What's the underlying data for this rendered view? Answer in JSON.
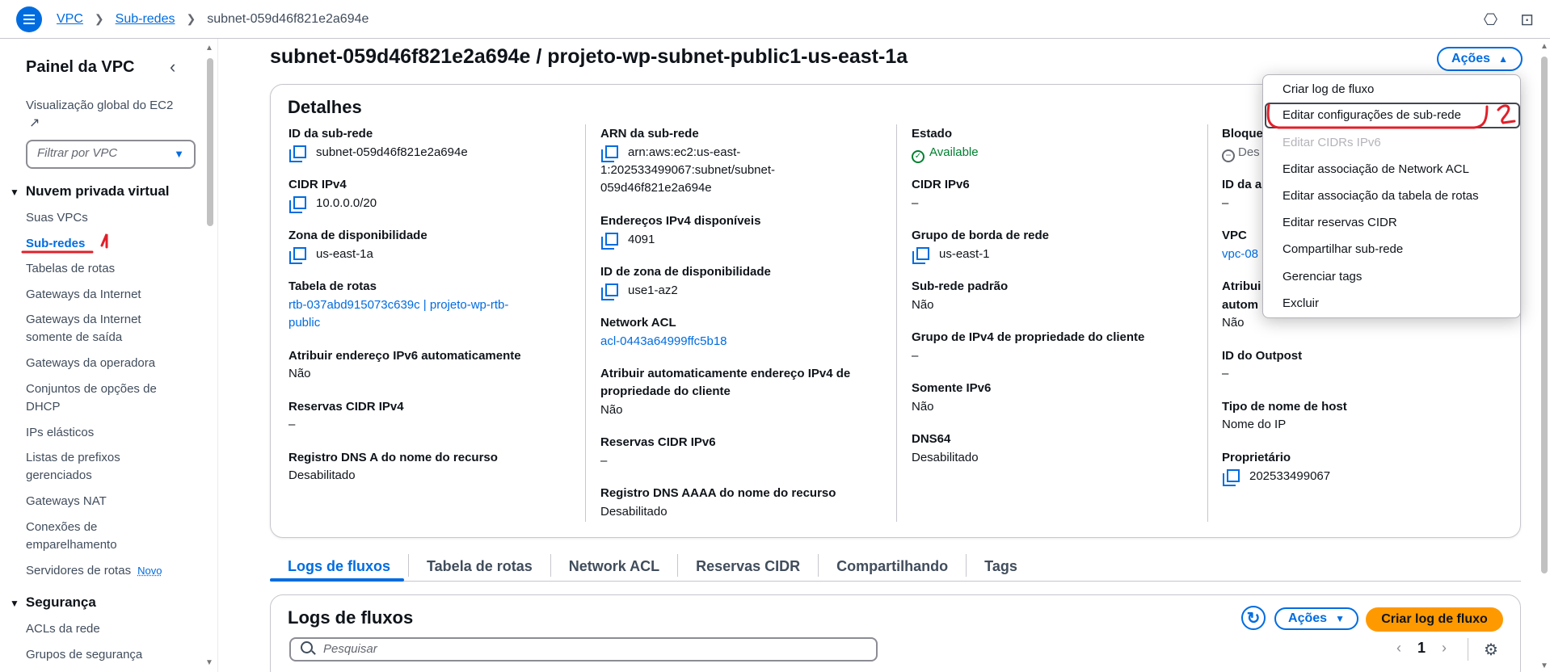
{
  "breadcrumb": {
    "items": [
      "VPC",
      "Sub-redes"
    ],
    "current": "subnet-059d46f821e2a694e"
  },
  "sidebar": {
    "title": "Painel da VPC",
    "ec2_global": "Visualização global do EC2",
    "filter_placeholder": "Filtrar por VPC",
    "section_vpc": "Nuvem privada virtual",
    "items": [
      "Suas VPCs",
      "Sub-redes",
      "Tabelas de rotas",
      "Gateways da Internet",
      "Gateways da Internet somente de saída",
      "Gateways da operadora",
      "Conjuntos de opções de DHCP",
      "IPs elásticos",
      "Listas de prefixos gerenciados",
      "Gateways NAT",
      "Conexões de emparelhamento",
      "Servidores de rotas"
    ],
    "new_badge": "Novo",
    "section_security": "Segurança",
    "security_items": [
      "ACLs da rede",
      "Grupos de segurança"
    ]
  },
  "main": {
    "title": "subnet-059d46f821e2a694e / projeto-wp-subnet-public1-us-east-1a",
    "actions_label": "Ações"
  },
  "details": {
    "title": "Detalhes",
    "col1": {
      "subnet_id_label": "ID da sub-rede",
      "subnet_id": "subnet-059d46f821e2a694e",
      "cidr_label": "CIDR IPv4",
      "cidr": "10.0.0.0/20",
      "az_label": "Zona de disponibilidade",
      "az": "us-east-1a",
      "rt_label": "Tabela de rotas",
      "rt_line1": "rtb-037abd915073c639c | projeto-wp-rtb-",
      "rt_line2": "public",
      "ipv6_auto_label": "Atribuir endereço IPv6 automaticamente",
      "ipv6_auto": "Não",
      "cidr_res_label": "Reservas CIDR IPv4",
      "cidr_res": "–",
      "dns_a_label": "Registro DNS A do nome do recurso",
      "dns_a": "Desabilitado"
    },
    "col2": {
      "arn_label": "ARN da sub-rede",
      "arn_line1": "arn:aws:ec2:us-east-",
      "arn_line2": "1:202533499067:subnet/subnet-",
      "arn_line3": "059d46f821e2a694e",
      "avail_label": "Endereços IPv4 disponíveis",
      "avail": "4091",
      "azid_label": "ID de zona de disponibilidade",
      "azid": "use1-az2",
      "acl_label": "Network ACL",
      "acl": "acl-0443a64999ffc5b18",
      "auto_cust_label1": "Atribuir automaticamente endereço IPv4 de",
      "auto_cust_label2": "propriedade do cliente",
      "auto_cust": "Não",
      "cidr6_res_label": "Reservas CIDR IPv6",
      "cidr6_res": "–",
      "dns_aaaa_label": "Registro DNS AAAA do nome do recurso",
      "dns_aaaa": "Desabilitado"
    },
    "col3": {
      "state_label": "Estado",
      "state": "Available",
      "cidr6_label": "CIDR IPv6",
      "cidr6": "–",
      "border_label": "Grupo de borda de rede",
      "border": "us-east-1",
      "default_label": "Sub-rede padrão",
      "default": "Não",
      "cust_pool_label": "Grupo de IPv4 de propriedade do cliente",
      "cust_pool": "–",
      "ipv6only_label": "Somente IPv6",
      "ipv6only": "Não",
      "dns64_label": "DNS64",
      "dns64": "Desabilitado"
    },
    "col4": {
      "block_label": "Bloque",
      "block": "Des",
      "ida_label": "ID da a",
      "ida": "–",
      "vpc_label": "VPC",
      "vpc": "vpc-08",
      "attr_label1": "Atribui",
      "attr_label2": "autom",
      "attr": "Não",
      "outpost_label": "ID do Outpost",
      "outpost": "–",
      "hostname_label": "Tipo de nome de host",
      "hostname": "Nome do IP",
      "owner_label": "Proprietário",
      "owner": "202533499067"
    }
  },
  "dropdown": {
    "items": [
      "Criar log de fluxo",
      "Editar configurações de sub-rede",
      "Editar CIDRs IPv6",
      "Editar associação de Network ACL",
      "Editar associação da tabela de rotas",
      "Editar reservas CIDR",
      "Compartilhar sub-rede",
      "Gerenciar tags",
      "Excluir"
    ]
  },
  "tabs": [
    "Logs de fluxos",
    "Tabela de rotas",
    "Network ACL",
    "Reservas CIDR",
    "Compartilhando",
    "Tags"
  ],
  "logs": {
    "title": "Logs de fluxos",
    "actions_label": "Ações",
    "create_label": "Criar log de fluxo",
    "search_placeholder": "Pesquisar",
    "page": "1"
  },
  "colors": {
    "accent": "#006ce0",
    "primary_button": "#ff9900",
    "success": "#00802f",
    "annotation": "#e0202a"
  }
}
